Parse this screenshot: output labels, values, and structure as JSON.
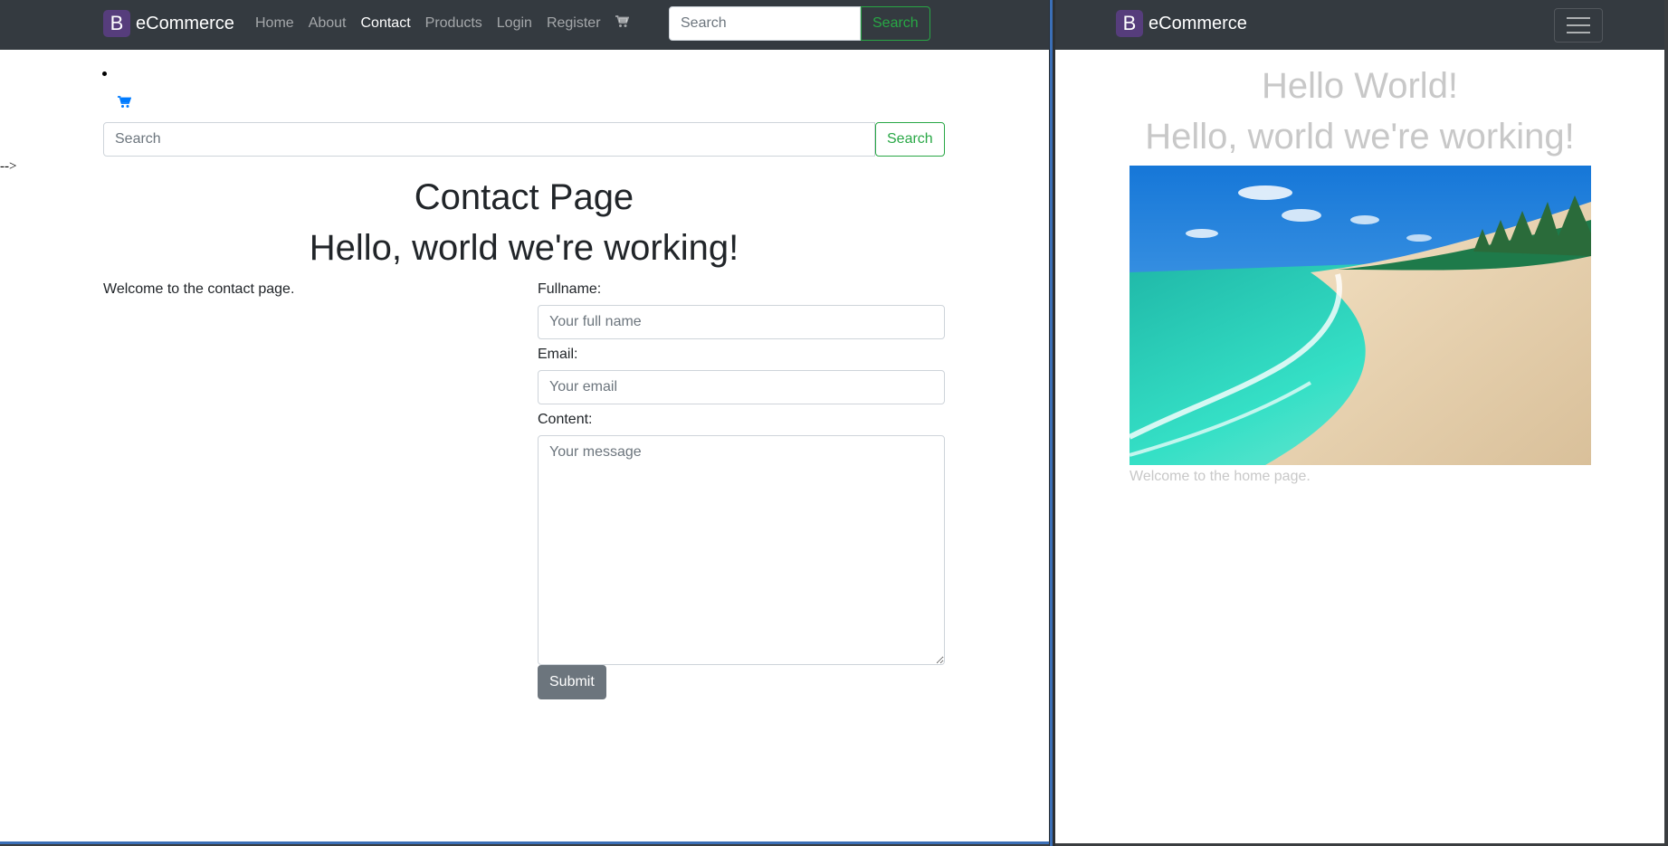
{
  "left": {
    "navbar": {
      "brand_logo": "B",
      "brand_name": "eCommerce",
      "links": [
        {
          "label": "Home"
        },
        {
          "label": "About"
        },
        {
          "label": "Contact"
        },
        {
          "label": "Products"
        },
        {
          "label": "Login"
        },
        {
          "label": "Register"
        }
      ],
      "active_link": "Contact",
      "cart_icon": "shopping-cart-icon",
      "search_placeholder": "Search",
      "search_button": "Search"
    },
    "body_search": {
      "placeholder": "Search",
      "button": "Search"
    },
    "comment_text": "-->",
    "page_title": "Contact Page",
    "heading": "Hello, world we're working!",
    "welcome_text": "Welcome to the contact page.",
    "form": {
      "fullname_label": "Fullname:",
      "fullname_placeholder": "Your full name",
      "email_label": "Email:",
      "email_placeholder": "Your email",
      "content_label": "Content:",
      "content_placeholder": "Your message",
      "submit_label": "Submit"
    }
  },
  "right": {
    "navbar": {
      "brand_logo": "B",
      "brand_name": "eCommerce",
      "toggler_icon": "hamburger-menu-icon"
    },
    "heading1": "Hello World!",
    "heading2": "Hello, world we're working!",
    "image": "beach-photo",
    "welcome_text": "Welcome to the home page."
  },
  "colors": {
    "navbar_bg": "#343a40",
    "brand_logo_bg": "#563d7c",
    "success": "#28a745",
    "secondary": "#6c757d",
    "link_blue": "#007bff",
    "divider_blue": "#3b6fb7"
  }
}
